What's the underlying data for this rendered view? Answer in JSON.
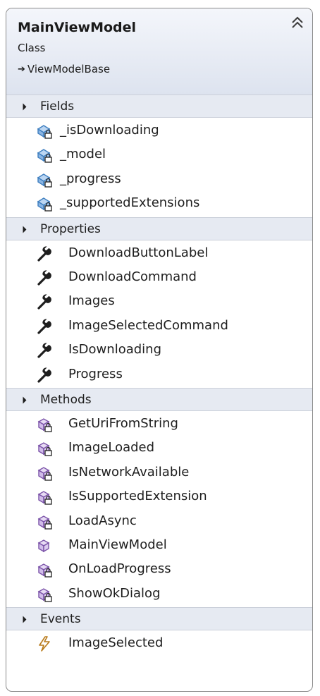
{
  "card": {
    "title": "MainViewModel",
    "kind": "Class",
    "base": "ViewModelBase"
  },
  "sections": [
    {
      "label": "Fields",
      "icon": "field-private-icon",
      "items": [
        "_isDownloading",
        "_model",
        "_progress",
        "_supportedExtensions"
      ]
    },
    {
      "label": "Properties",
      "icon": "property-wrench-icon",
      "items": [
        "DownloadButtonLabel",
        "DownloadCommand",
        "Images",
        "ImageSelectedCommand",
        "IsDownloading",
        "Progress"
      ]
    },
    {
      "label": "Methods",
      "icon": "method-private-icon",
      "items": [
        "GetUriFromString",
        "ImageLoaded",
        "IsNetworkAvailable",
        "IsSupportedExtension",
        "LoadAsync",
        "MainViewModel",
        "OnLoadProgress",
        "ShowOkDialog"
      ]
    },
    {
      "label": "Events",
      "icon": "event-lightning-icon",
      "items": [
        "ImageSelected"
      ]
    }
  ],
  "colors": {
    "header_bg": "#dde3ef",
    "section_bg": "#e6eaf2",
    "field_icon": "#3f7fc0",
    "method_icon": "#7a52a8",
    "event_icon": "#b87a1a"
  }
}
